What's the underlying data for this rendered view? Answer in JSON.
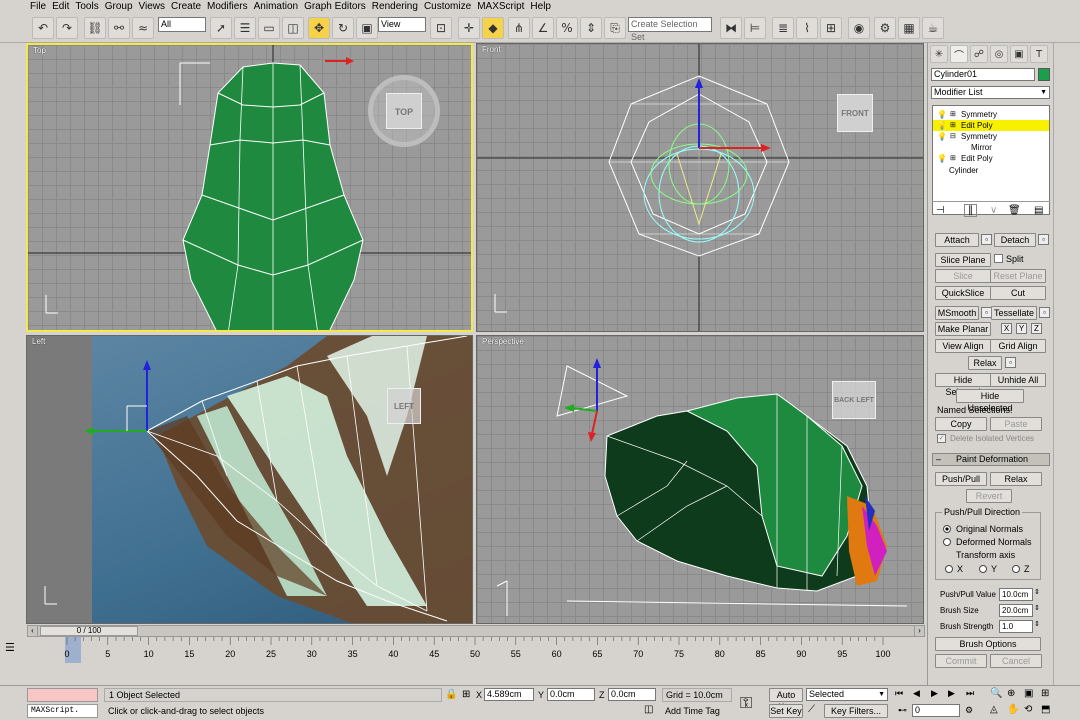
{
  "menu": [
    "File",
    "Edit",
    "Tools",
    "Group",
    "Views",
    "Create",
    "Modifiers",
    "Animation",
    "Graph Editors",
    "Rendering",
    "Customize",
    "MAXScript",
    "Help"
  ],
  "toolbar": {
    "selection_filter": "All",
    "ref_coord": "View",
    "selection_set_placeholder": "Create Selection Set"
  },
  "viewports": {
    "top": "Top",
    "front": "Front",
    "left": "Left",
    "perspective": "Perspective",
    "cube_top": "TOP",
    "cube_front": "FRONT",
    "cube_left": "LEFT",
    "cube_persp_a": "BACK",
    "cube_persp_b": "LEFT"
  },
  "command_panel": {
    "object_name": "Cylinder01",
    "modifier_list": "Modifier List",
    "stack": [
      {
        "label": "Symmetry",
        "selected": false
      },
      {
        "label": "Edit Poly",
        "selected": true
      },
      {
        "label": "Symmetry",
        "selected": false
      },
      {
        "label": "Mirror",
        "selected": false
      },
      {
        "label": "Edit Poly",
        "selected": false
      },
      {
        "label": "Cylinder",
        "selected": false
      }
    ],
    "attach": "Attach",
    "detach": "Detach",
    "slice_plane": "Slice Plane",
    "split": "Split",
    "slice": "Slice",
    "reset_plane": "Reset Plane",
    "quickslice": "QuickSlice",
    "cut": "Cut",
    "msmooth": "MSmooth",
    "tessellate": "Tessellate",
    "make_planar": "Make Planar",
    "x": "X",
    "y": "Y",
    "z": "Z",
    "view_align": "View Align",
    "grid_align": "Grid Align",
    "relax": "Relax",
    "hide_selected": "Hide Selected",
    "unhide_all": "Unhide All",
    "hide_unselected": "Hide Unselected",
    "named_selections": "Named Selections:",
    "copy": "Copy",
    "paste": "Paste",
    "delete_isolated": "Delete Isolated Vertices",
    "paint_deformation": "Paint Deformation",
    "push_pull": "Push/Pull",
    "relax2": "Relax",
    "revert": "Revert",
    "push_pull_direction": "Push/Pull Direction",
    "original_normals": "Original Normals",
    "deformed_normals": "Deformed Normals",
    "transform_axis": "Transform axis",
    "ax_x": "X",
    "ax_y": "Y",
    "ax_z": "Z",
    "push_pull_value_lbl": "Push/Pull Value",
    "push_pull_value": "10.0cm",
    "brush_size_lbl": "Brush Size",
    "brush_size": "20.0cm",
    "brush_strength_lbl": "Brush Strength",
    "brush_strength": "1.0",
    "brush_options": "Brush Options",
    "commit": "Commit",
    "cancel": "Cancel"
  },
  "timeline": {
    "slider": "0 / 100",
    "ticks": [
      "0",
      "5",
      "10",
      "15",
      "20",
      "25",
      "30",
      "35",
      "40",
      "45",
      "50",
      "55",
      "60",
      "65",
      "70",
      "75",
      "80",
      "85",
      "90",
      "95",
      "100"
    ]
  },
  "status": {
    "maxscript": "MAXScript.",
    "objects_selected": "1 Object Selected",
    "prompt": "Click or click-and-drag to select objects",
    "x_val": "4.589cm",
    "y_val": "0.0cm",
    "z_val": "0.0cm",
    "x_lbl": "X",
    "y_lbl": "Y",
    "z_lbl": "Z",
    "grid": "Grid = 10.0cm",
    "add_time_tag": "Add Time Tag",
    "auto_key": "Auto Key",
    "set_key": "Set Key",
    "key_mode": "Selected",
    "key_filters": "Key Filters...",
    "frame": "0"
  }
}
